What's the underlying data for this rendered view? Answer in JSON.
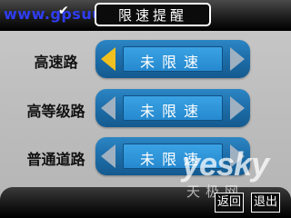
{
  "header": {
    "watermark_url": "www.gpsuu.com",
    "title": "限速提醒",
    "check_icon": "check-icon"
  },
  "rows": [
    {
      "label": "高速路",
      "value": "未限速",
      "left_active": true
    },
    {
      "label": "高等级路",
      "value": "未限速",
      "left_active": false
    },
    {
      "label": "普通道路",
      "value": "未限速",
      "left_active": false
    }
  ],
  "footer": {
    "back_label": "返回",
    "exit_label": "退出"
  },
  "watermark": {
    "brand": "yesky",
    "sub": "天极网"
  },
  "colors": {
    "selector_blue": "#1e6fab",
    "value_blue": "#2689cf",
    "active_arrow": "#f0c020",
    "inactive_arrow": "#9fb0c0"
  }
}
